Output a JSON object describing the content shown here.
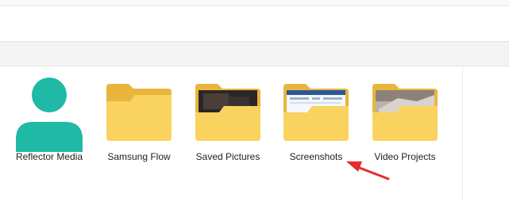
{
  "folders": [
    {
      "name": "Reflector Media",
      "icon": "user-icon"
    },
    {
      "name": "Samsung Flow",
      "icon": "folder-icon"
    },
    {
      "name": "Saved Pictures",
      "icon": "folder-dark-photo-icon"
    },
    {
      "name": "Screenshots",
      "icon": "folder-screenshot-icon"
    },
    {
      "name": "Video Projects",
      "icon": "folder-video-icon"
    }
  ],
  "colors": {
    "folder_back": "#e9b53b",
    "folder_front": "#fad25f",
    "user_icon": "#1fb9a6",
    "arrow": "#e52b2b"
  }
}
